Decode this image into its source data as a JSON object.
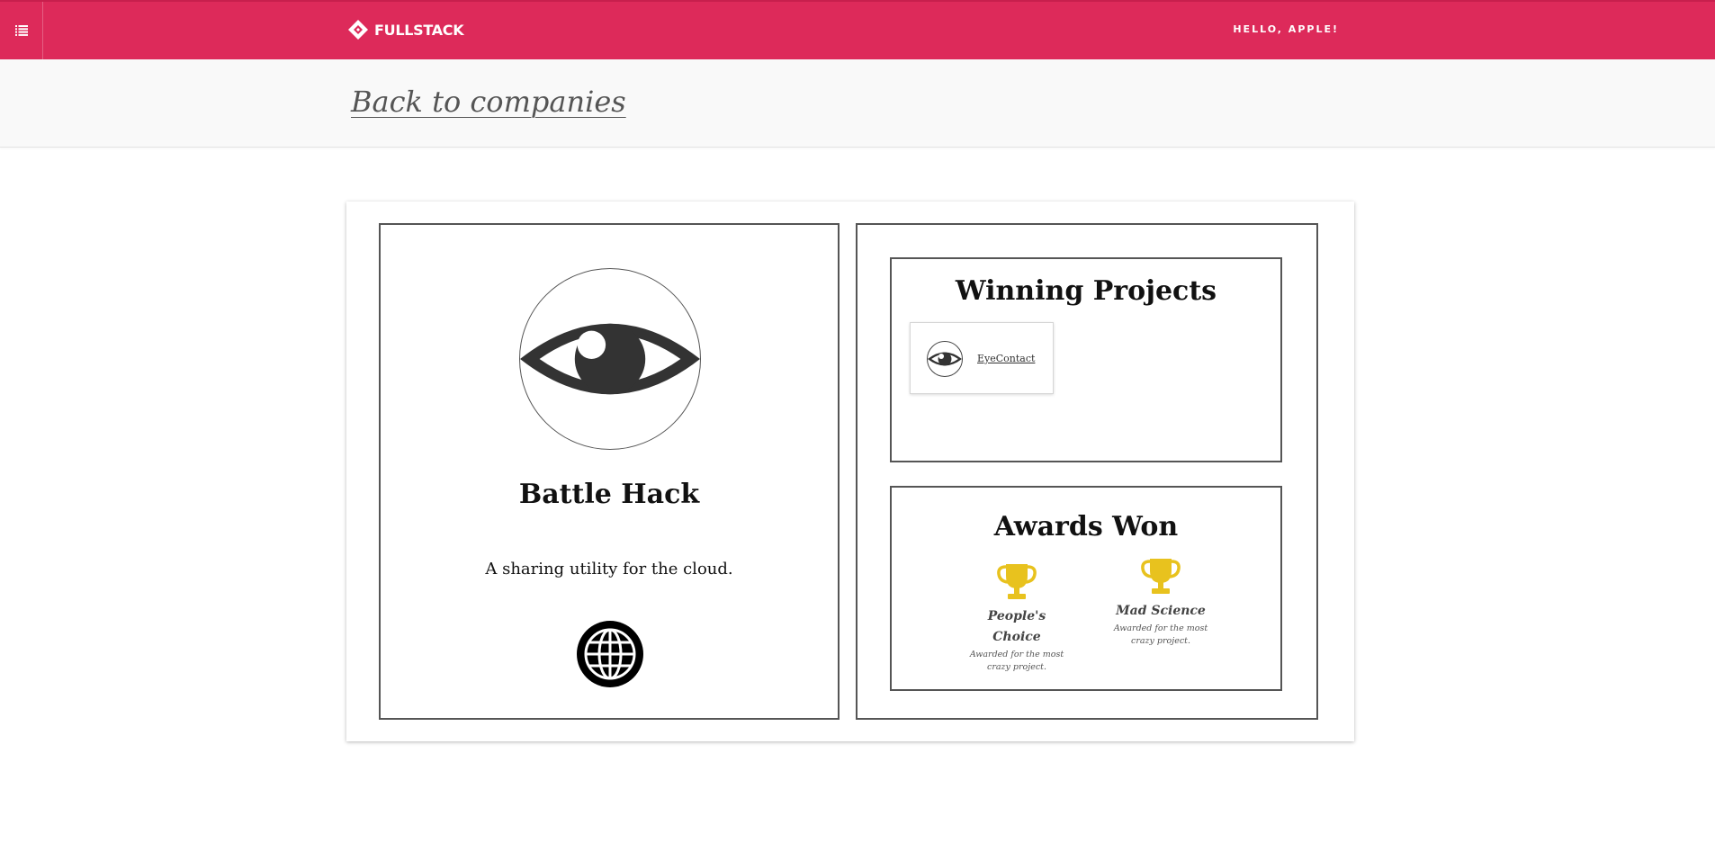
{
  "header": {
    "brand": "FULLSTACK",
    "greeting": "HELLO, APPLE!"
  },
  "nav": {
    "back_link": "Back to companies"
  },
  "company": {
    "name": "Battle Hack",
    "description": "A sharing utility for the cloud.",
    "logo_icon": "eye-icon",
    "website_icon": "globe-icon"
  },
  "winning_projects": {
    "title": "Winning Projects",
    "projects": [
      {
        "name": "EyeContact",
        "icon": "eye-icon"
      }
    ]
  },
  "awards": {
    "title": "Awards Won",
    "items": [
      {
        "name": "People's Choice",
        "description": "Awarded for the most crazy project.",
        "icon": "trophy-icon"
      },
      {
        "name": "Mad Science",
        "description": "Awarded for the most crazy project.",
        "icon": "trophy-icon"
      }
    ]
  },
  "colors": {
    "brand": "#dd2a5a",
    "trophy": "#e8c21e",
    "border": "#555555"
  }
}
